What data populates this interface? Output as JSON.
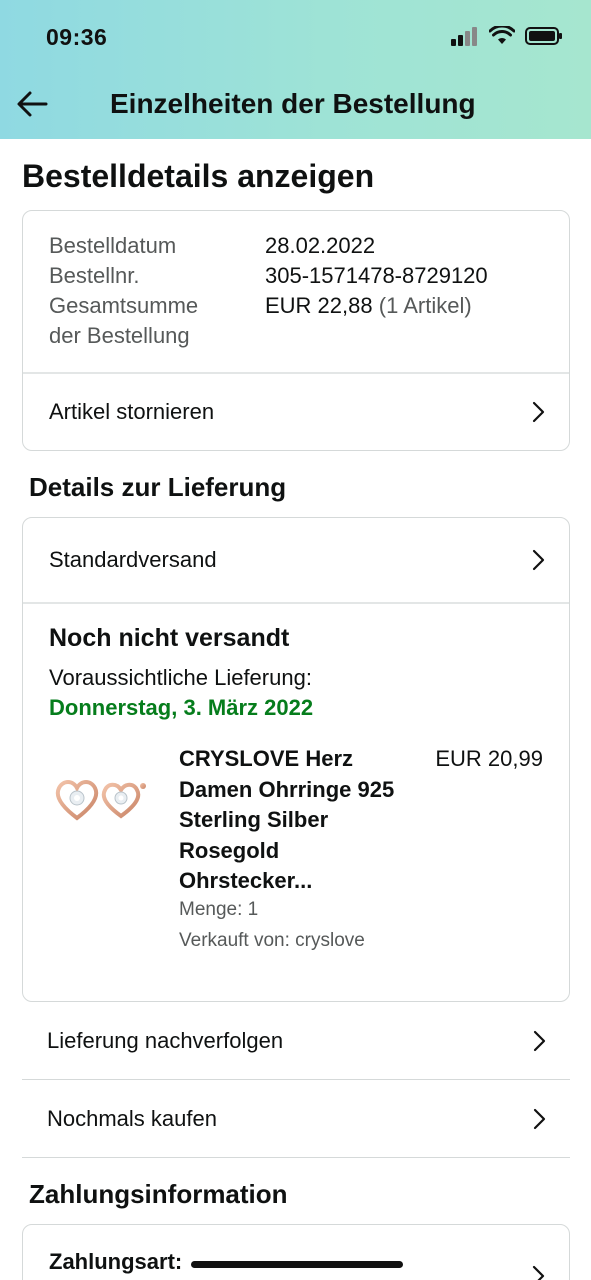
{
  "status_bar": {
    "time": "09:36"
  },
  "header": {
    "title": "Einzelheiten der Bestellung"
  },
  "page_title": "Bestelldetails anzeigen",
  "order_summary": {
    "date_label": "Bestelldatum",
    "date_value": "28.02.2022",
    "number_label": "Bestellnr.",
    "number_value": "305-1571478-8729120",
    "total_label_line1": "Gesamtsumme",
    "total_label_line2": "der Bestellung",
    "total_value": "EUR 22,88",
    "total_items": "(1 Artikel)",
    "cancel_label": "Artikel stornieren"
  },
  "delivery": {
    "section_title": "Details zur Lieferung",
    "shipping_method": "Standardversand",
    "status": "Noch nicht versandt",
    "expected_label": "Voraussichtliche Lieferung:",
    "expected_date": "Donnerstag, 3. März 2022",
    "expected_date_color": "#067d1c",
    "product": {
      "title_lines": [
        "CRYSLOVE Herz",
        "Damen Ohrringe 925",
        "Sterling Silber",
        "Rosegold",
        "Ohrstecker..."
      ],
      "price": "EUR 20,99",
      "quantity": "Menge: 1",
      "seller": "Verkauft von: cryslove"
    }
  },
  "actions": {
    "track": "Lieferung nachverfolgen",
    "buy_again": "Nochmals kaufen"
  },
  "payment": {
    "section_title": "Zahlungsinformation",
    "method_label": "Zahlungsart:"
  },
  "colors": {
    "header_gradient_start": "#8fd9e2",
    "header_gradient_end": "#a6e6cf",
    "delivery_green": "#067d1c"
  }
}
